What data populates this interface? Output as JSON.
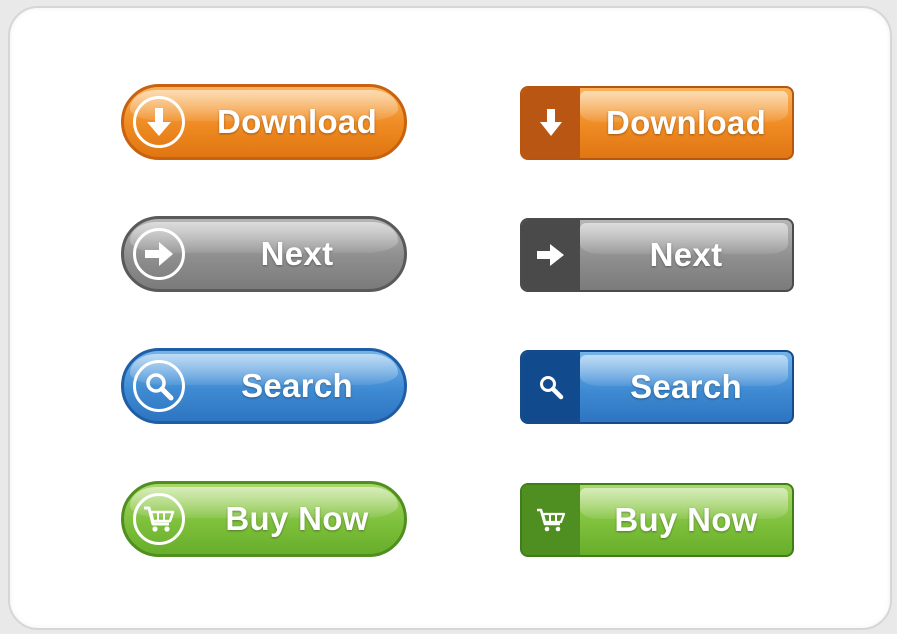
{
  "buttons": {
    "download_pill": {
      "label": "Download",
      "icon": "arrow-down-circle-icon",
      "color": "#ef8a22"
    },
    "download_rect": {
      "label": "Download",
      "icon": "arrow-down-icon",
      "color": "#ef8a22"
    },
    "next_pill": {
      "label": "Next",
      "icon": "arrow-right-circle-icon",
      "color": "#8e8e8e"
    },
    "next_rect": {
      "label": "Next",
      "icon": "arrow-right-icon",
      "color": "#8e8e8e"
    },
    "search_pill": {
      "label": "Search",
      "icon": "magnifier-circle-icon",
      "color": "#3f8bd3"
    },
    "search_rect": {
      "label": "Search",
      "icon": "magnifier-icon",
      "color": "#3f8bd3"
    },
    "buy_pill": {
      "label": "Buy Now",
      "icon": "cart-circle-icon",
      "color": "#7ec03c"
    },
    "buy_rect": {
      "label": "Buy Now",
      "icon": "cart-icon",
      "color": "#7ec03c"
    }
  }
}
